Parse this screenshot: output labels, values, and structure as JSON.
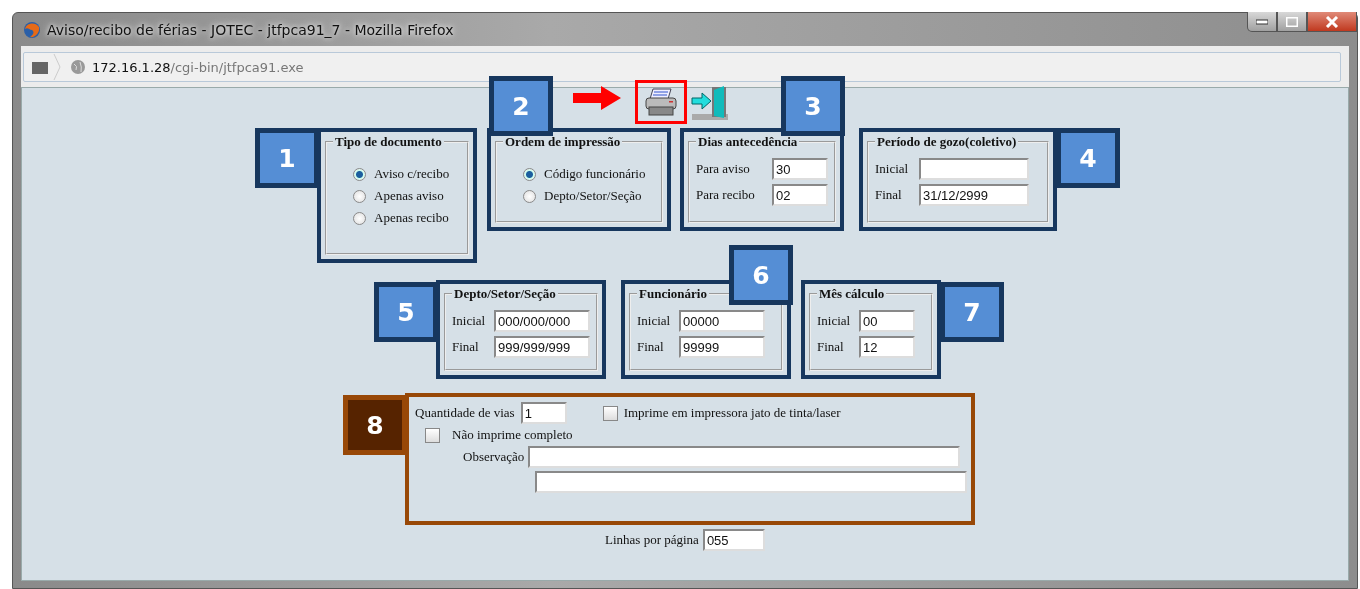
{
  "window": {
    "title": "Aviso/recibo de férias - JOTEC - jtfpca91_7 - Mozilla Firefox"
  },
  "address": {
    "host": "172.16.1.28",
    "path": "/cgi-bin/jtfpca91.exe"
  },
  "sections": [
    {
      "kind": "radio",
      "callout": "1",
      "legend": "Tipo de documento",
      "options": [
        {
          "label": "Aviso c/recibo",
          "selected": true
        },
        {
          "label": "Apenas aviso",
          "selected": false
        },
        {
          "label": "Apenas recibo",
          "selected": false
        }
      ]
    },
    {
      "kind": "radio",
      "callout": "2",
      "legend": "Ordem de impressão",
      "options": [
        {
          "label": "Código funcionário",
          "selected": true
        },
        {
          "label": "Depto/Setor/Seção",
          "selected": false
        }
      ]
    },
    {
      "kind": "fields",
      "callout": "3",
      "legend": "Dias antecedência",
      "fields": [
        {
          "label": "Para aviso",
          "value": "30"
        },
        {
          "label": "Para recibo",
          "value": "02"
        }
      ]
    },
    {
      "kind": "fields",
      "callout": "4",
      "legend": "Período de gozo(coletivo)",
      "fields": [
        {
          "label": "Inicial"
        },
        {
          "label": "Final",
          "value": "31/12/2999"
        }
      ]
    },
    {
      "kind": "fields",
      "callout": "5",
      "legend": "Depto/Setor/Seção",
      "fields": [
        {
          "label": "Inicial",
          "value": "000/000/000"
        },
        {
          "label": "Final",
          "value": "999/999/999"
        }
      ]
    },
    {
      "kind": "fields",
      "callout": "6",
      "legend": "Funcionário",
      "fields": [
        {
          "label": "Inicial",
          "value": "00000"
        },
        {
          "label": "Final",
          "value": "99999"
        }
      ]
    },
    {
      "kind": "fields",
      "callout": "7",
      "legend": "Mês cálculo",
      "fields": [
        {
          "label": "Inicial",
          "value": "00"
        },
        {
          "label": "Final",
          "value": "12"
        }
      ]
    }
  ],
  "options_panel": {
    "callout": "8",
    "quantidade_vias": {
      "label": "Quantidade de vias",
      "value": "1"
    },
    "jato_tinta": {
      "label": "Imprime em impressora jato de tinta/laser",
      "checked": false
    },
    "nao_imprime_completo": {
      "label": "Não imprime completo",
      "checked": false
    },
    "observacao": {
      "label": "Observação"
    }
  },
  "linhas_por_pagina": {
    "label": "Linhas por página",
    "value": "055"
  }
}
